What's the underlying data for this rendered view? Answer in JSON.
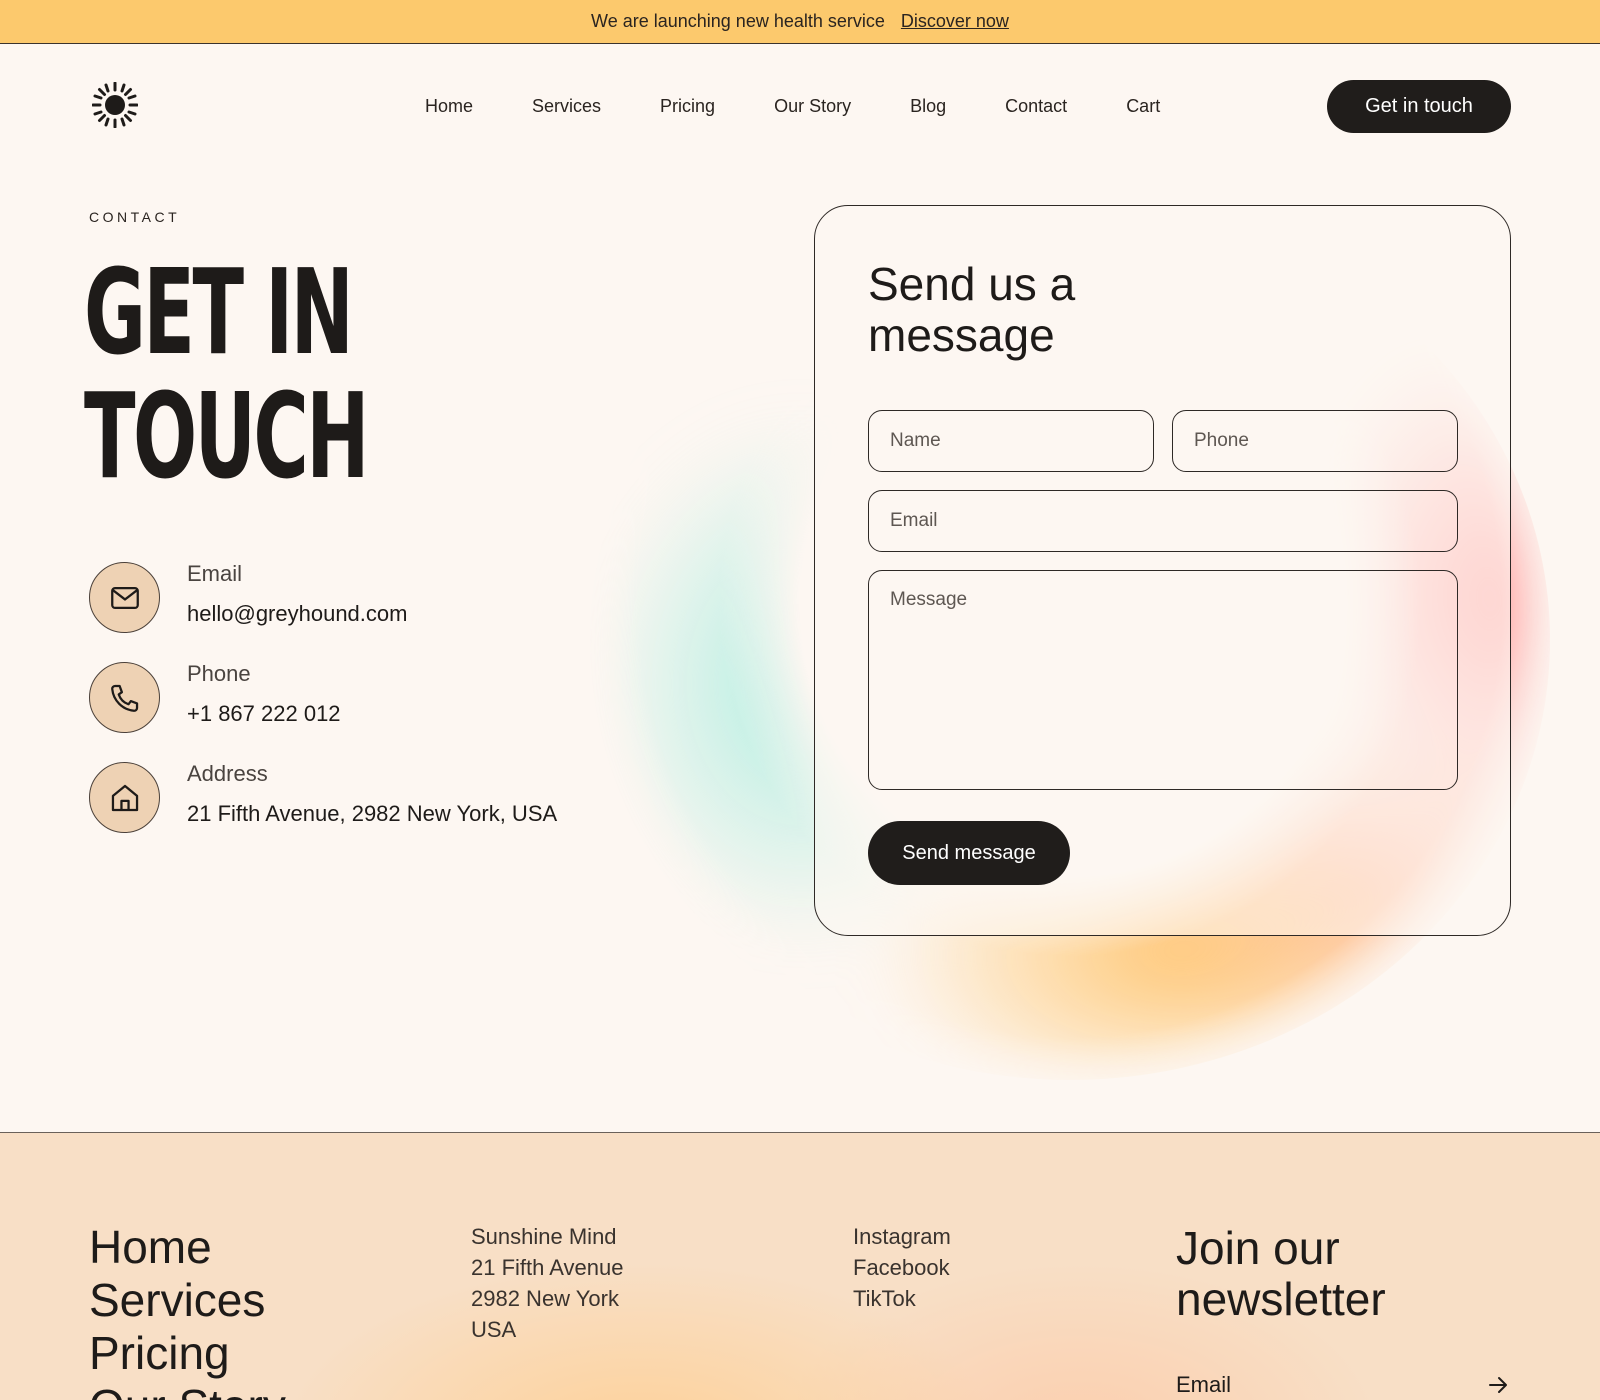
{
  "announcement": {
    "text": "We are launching new health service",
    "link": "Discover now"
  },
  "nav": {
    "items": [
      "Home",
      "Services",
      "Pricing",
      "Our Story",
      "Blog",
      "Contact",
      "Cart"
    ],
    "cta": "Get in touch"
  },
  "hero": {
    "eyebrow": "CONTACT",
    "title_line1": "GET IN",
    "title_line2": "TOUCH"
  },
  "contact": [
    {
      "label": "Email",
      "value": "hello@greyhound.com",
      "icon": "mail-icon"
    },
    {
      "label": "Phone",
      "value": "+1 867 222 012",
      "icon": "phone-icon"
    },
    {
      "label": "Address",
      "value": "21 Fifth Avenue, 2982 New York, USA",
      "icon": "home-icon"
    }
  ],
  "form": {
    "title": "Send us a message",
    "name_placeholder": "Name",
    "phone_placeholder": "Phone",
    "email_placeholder": "Email",
    "message_placeholder": "Message",
    "submit": "Send message"
  },
  "footer": {
    "nav": [
      "Home",
      "Services",
      "Pricing",
      "Our Story"
    ],
    "address": [
      "Sunshine Mind",
      "21 Fifth Avenue",
      "2982 New York",
      "USA"
    ],
    "social": [
      "Instagram",
      "Facebook",
      "TikTok"
    ],
    "newsletter_title": "Join our newsletter",
    "newsletter_placeholder": "Email"
  },
  "colors": {
    "announcement_bg": "#fcc96d",
    "page_bg": "#fdf7f2",
    "dark": "#201d1b",
    "icon_circle": "#eed2b4",
    "footer_bg": "#f8dfc6"
  }
}
